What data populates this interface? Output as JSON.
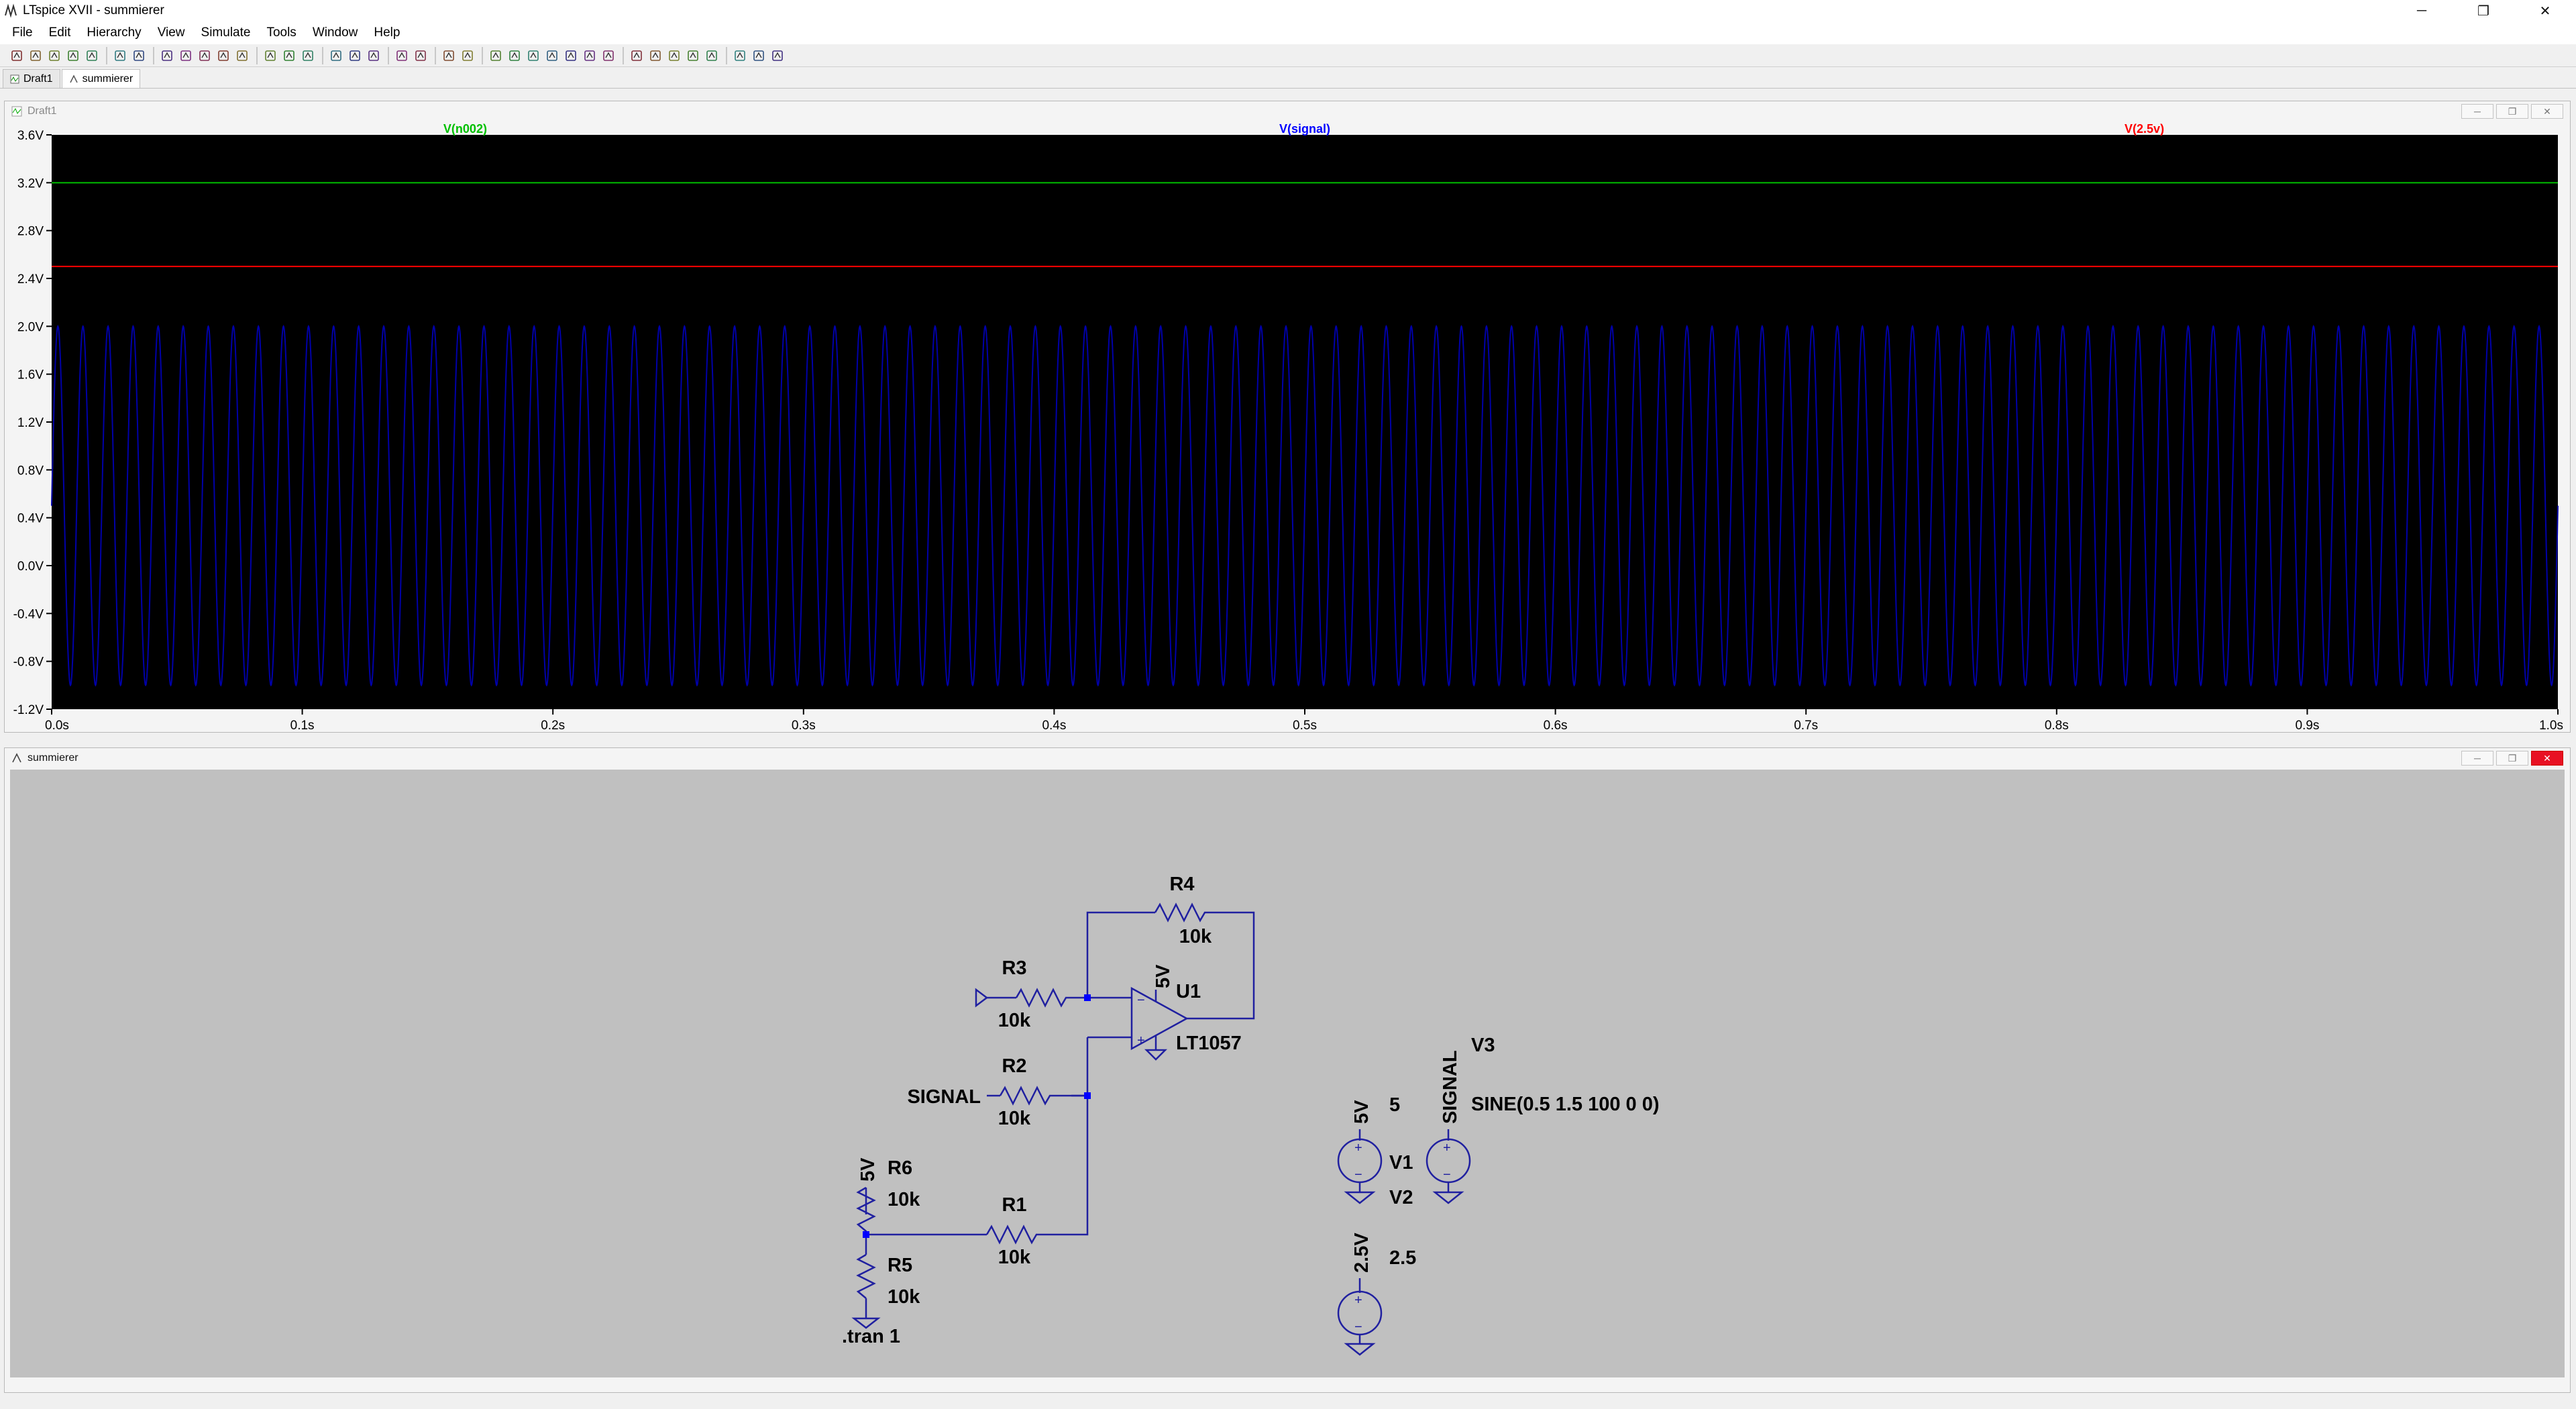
{
  "window": {
    "title": "LTspice XVII - summierer",
    "minimize": "─",
    "restore": "❐",
    "close": "✕"
  },
  "menu": [
    "File",
    "Edit",
    "Hierarchy",
    "View",
    "Simulate",
    "Tools",
    "Window",
    "Help"
  ],
  "toolbar_icons": [
    "run-icon",
    "open-icon",
    "save-icon",
    "control-panel-icon",
    "halt-icon",
    "pan-icon",
    "zoom-in-icon",
    "zoom-area-icon",
    "zoom-out-icon",
    "zoom-fit-icon",
    "autorange-icon",
    "plot-settings-icon",
    "tile-horizontal-icon",
    "cascade-icon",
    "tile-vertical-icon",
    "cut-icon",
    "copy-icon",
    "paste-icon",
    "find-icon",
    "print-icon",
    "print-preview-icon",
    "wire-icon",
    "ground-icon",
    "label-net-icon",
    "resistor-icon",
    "capacitor-icon",
    "inductor-icon",
    "diode-icon",
    "component-icon",
    "move-icon",
    "drag-icon",
    "undo-icon",
    "redo-icon",
    "rotate-icon",
    "mirror-icon",
    "text-icon",
    "spice-directive-icon"
  ],
  "tabs": [
    {
      "label": "Draft1",
      "active": false
    },
    {
      "label": "summierer",
      "active": true
    }
  ],
  "waveform": {
    "window_title": "Draft1",
    "traces": [
      {
        "name": "V(n002)",
        "color": "#00c000"
      },
      {
        "name": "V(signal)",
        "color": "#0000ff"
      },
      {
        "name": "V(2.5v)",
        "color": "#ff0000"
      }
    ]
  },
  "chart_data": {
    "type": "line",
    "xlabel": "",
    "ylabel": "",
    "xlim": [
      0,
      1.0
    ],
    "ylim": [
      -1.2,
      3.6
    ],
    "x_ticks": [
      "0.0s",
      "0.1s",
      "0.2s",
      "0.3s",
      "0.4s",
      "0.5s",
      "0.6s",
      "0.7s",
      "0.8s",
      "0.9s",
      "1.0s"
    ],
    "y_ticks": [
      "3.6V",
      "3.2V",
      "2.8V",
      "2.4V",
      "2.0V",
      "1.6V",
      "1.2V",
      "0.8V",
      "0.4V",
      "0.0V",
      "-0.4V",
      "-0.8V",
      "-1.2V"
    ],
    "series": [
      {
        "name": "V(n002)",
        "color": "#00c000",
        "kind": "constant",
        "value": 3.2
      },
      {
        "name": "V(signal)",
        "color": "#0000a8",
        "kind": "sine",
        "offset": 0.5,
        "amplitude": 1.5,
        "frequency": 100
      },
      {
        "name": "V(2.5v)",
        "color": "#ff0000",
        "kind": "constant",
        "value": 2.5
      }
    ]
  },
  "schematic": {
    "window_title": "summierer",
    "labels": {
      "r4": "R4",
      "r4_val": "10k",
      "r3": "R3",
      "r3_val": "10k",
      "r2": "R2",
      "r2_val": "10k",
      "r1": "R1",
      "r1_val": "10k",
      "r6": "R6",
      "r6_val": "10k",
      "r5": "R5",
      "r5_val": "10k",
      "u1": "U1",
      "u1_model": "LT1057",
      "u1_supply": "5V",
      "signal_in": "SIGNAL",
      "r6_supply": "5V",
      "v1": "V1",
      "v1_val": "5",
      "v1_net": "5V",
      "v3": "V3",
      "v3_val": "SINE(0.5 1.5 100 0 0)",
      "v3_net": "SIGNAL",
      "v2": "V2",
      "v2_val": "2.5",
      "v2_net": "2.5V",
      "directive": ".tran 1"
    }
  }
}
